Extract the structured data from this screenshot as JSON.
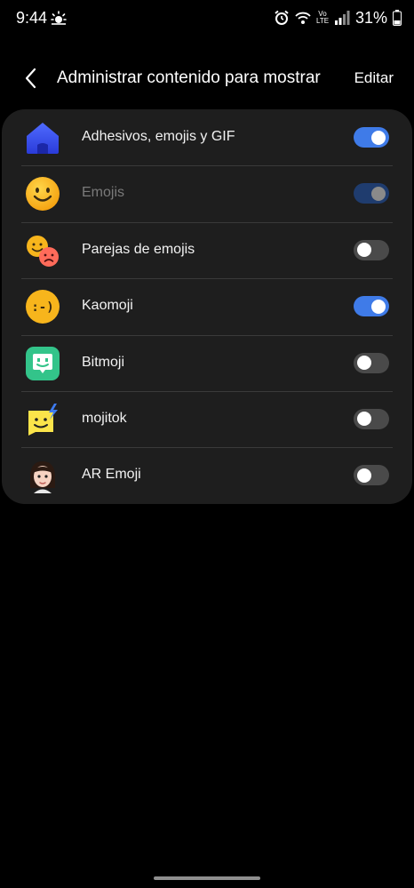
{
  "status_bar": {
    "time": "9:44",
    "battery_percent": "31%",
    "network_label": "Vo LTE"
  },
  "header": {
    "title": "Administrar contenido para mostrar",
    "edit_label": "Editar"
  },
  "items": [
    {
      "label": "Adhesivos, emojis y GIF",
      "icon": "home-icon",
      "enabled": true,
      "disabled": false
    },
    {
      "label": "Emojis",
      "icon": "smiley-emoji-icon",
      "enabled": true,
      "disabled": true
    },
    {
      "label": "Parejas de emojis",
      "icon": "emoji-pairs-icon",
      "enabled": false,
      "disabled": false
    },
    {
      "label": "Kaomoji",
      "icon": "kaomoji-icon",
      "enabled": true,
      "disabled": false
    },
    {
      "label": "Bitmoji",
      "icon": "bitmoji-icon",
      "enabled": false,
      "disabled": false
    },
    {
      "label": "mojitok",
      "icon": "mojitok-icon",
      "enabled": false,
      "disabled": false
    },
    {
      "label": "AR Emoji",
      "icon": "ar-emoji-avatar-icon",
      "enabled": false,
      "disabled": false
    }
  ],
  "colors": {
    "toggle_on": "#3f7be8",
    "toggle_off": "#4a4a4a",
    "card_bg": "#1e1e1e"
  }
}
